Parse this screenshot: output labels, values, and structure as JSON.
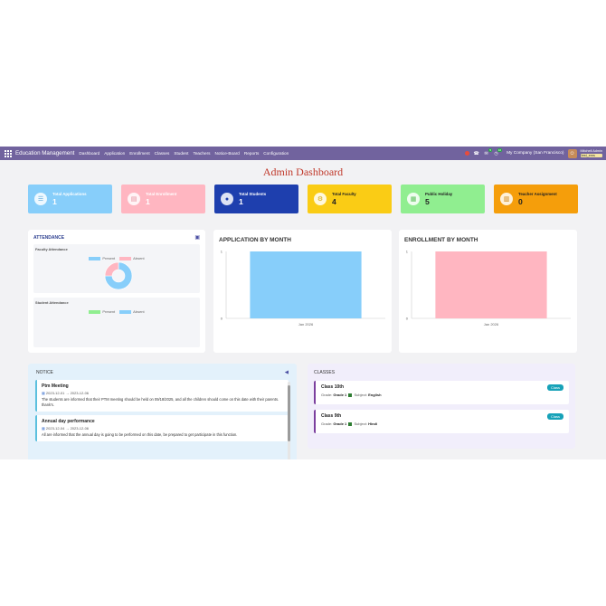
{
  "navbar": {
    "brand": "Education Management",
    "menu": [
      "Dashboard",
      "Application",
      "Enrollment",
      "Classes",
      "Student",
      "Teachers",
      "Notice-Board",
      "Reports",
      "Configuration"
    ],
    "chat_badge": "5",
    "activity_badge": "10",
    "company": "My Company (San Francisco)",
    "user_name": "Mitchell Admin",
    "db_name": "test_ems"
  },
  "page_title": "Admin Dashboard",
  "cards": [
    {
      "label": "Total Applications",
      "value": "1",
      "color": "#87cefa",
      "icon": "list-icon"
    },
    {
      "label": "Total Enrollment",
      "value": "1",
      "color": "#ffb6c1",
      "icon": "id-card-icon"
    },
    {
      "label": "Total Students",
      "value": "1",
      "color": "#1e3fae",
      "icon": "user-icon"
    },
    {
      "label": "Total Faculty",
      "value": "4",
      "color": "#facc15",
      "icon": "gears-icon"
    },
    {
      "label": "Public Holiday",
      "value": "5",
      "color": "#90ee90",
      "icon": "calendar-icon"
    },
    {
      "label": "Teacher Assignment",
      "value": "0",
      "color": "#f59e0b",
      "icon": "book-icon"
    }
  ],
  "attendance": {
    "title": "ATTENDANCE",
    "faculty_title": "Faculty Attendance",
    "student_title": "Student Attendance",
    "present_label": "Present",
    "absent_label": "Absent"
  },
  "notice": {
    "title": "NOTICE",
    "items": [
      {
        "title": "Ptm Meeting",
        "date": "2023-12-01 → 2023-12-06",
        "body": "The students are informed that their PTM meeting should be held on 09/18/2025, and all the children should come on this date with their parents. thank's."
      },
      {
        "title": "Annual day performance",
        "date": "2023-12-04 → 2023-12-06",
        "body": "All are informed that the annual day is going to be performed on this date, be prepared to get participate in this function."
      }
    ]
  },
  "classes": {
    "title": "CLASSES",
    "items": [
      {
        "name": "Class 10th",
        "grade_label": "Grade:",
        "grade": "Grade 1",
        "subject_label": "Subject:",
        "subject": "English",
        "badge": "Class"
      },
      {
        "name": "Class 9th",
        "grade_label": "Grade:",
        "grade": "Grade 1",
        "subject_label": "Subject:",
        "subject": "Hindi",
        "badge": "Class"
      }
    ]
  },
  "chart_data": [
    {
      "type": "bar",
      "title": "APPLICATION BY MONTH",
      "categories": [
        "Jan 2026"
      ],
      "values": [
        1
      ],
      "ylim": [
        0,
        1
      ],
      "yticks": [
        "0",
        "1"
      ],
      "color": "#87cefa"
    },
    {
      "type": "bar",
      "title": "ENROLLMENT BY MONTH",
      "categories": [
        "Jan 2026"
      ],
      "values": [
        1
      ],
      "ylim": [
        0,
        1
      ],
      "yticks": [
        "0",
        "1"
      ],
      "color": "#ffb6c1"
    },
    {
      "type": "pie",
      "title": "Faculty Attendance",
      "categories": [
        "Present",
        "Absent"
      ],
      "values": [
        75,
        25
      ],
      "colors": [
        "#87cefa",
        "#ffb6c1"
      ]
    }
  ]
}
